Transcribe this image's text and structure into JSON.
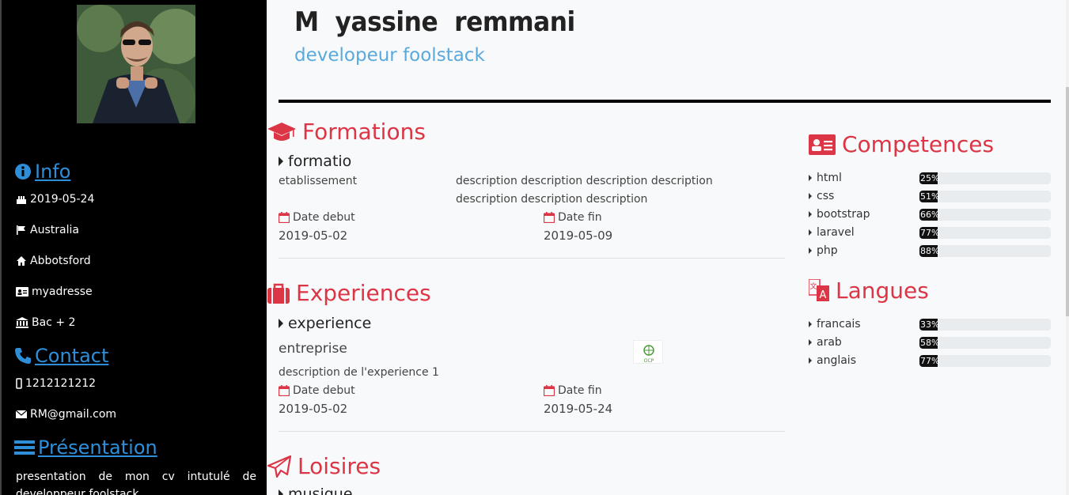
{
  "sidebar": {
    "info_heading": "Info",
    "info_items": [
      "2019-05-24",
      "Australia",
      "Abbotsford",
      "myadresse",
      "Bac + 2"
    ],
    "contact_heading": "Contact",
    "phone": "1212121212",
    "email": "RM@gmail.com",
    "presentation_heading": "Présentation",
    "presentation_text": "presentation de mon cv intutulé de developpeur foolstack"
  },
  "header": {
    "name": "M  yassine  remmani",
    "role": "developeur foolstack"
  },
  "formations": {
    "title": "Formations",
    "item_title": "formatio",
    "etablissement": "etablissement",
    "description_line1": "description description description description",
    "description_line2": "description description description",
    "date_debut_label": "Date debut",
    "date_debut": "2019-05-02",
    "date_fin_label": "Date fin",
    "date_fin": "2019-05-09"
  },
  "experiences": {
    "title": "Experiences",
    "item_title": "experience",
    "entreprise": "entreprise",
    "description": "description de l'experience 1",
    "date_debut_label": "Date debut",
    "date_debut": "2019-05-02",
    "date_fin_label": "Date fin",
    "date_fin": "2019-05-24",
    "logo_text": "OCP"
  },
  "loisires": {
    "title": "Loisires",
    "item_title": "musique"
  },
  "competences": {
    "title": "Competences",
    "items": [
      {
        "name": "html",
        "percent": 25,
        "label": "25%"
      },
      {
        "name": "css",
        "percent": 51,
        "label": "51%"
      },
      {
        "name": "bootstrap",
        "percent": 66,
        "label": "66%"
      },
      {
        "name": "laravel",
        "percent": 77,
        "label": "77%"
      },
      {
        "name": "php",
        "percent": 88,
        "label": "88%"
      }
    ]
  },
  "langues": {
    "title": "Langues",
    "items": [
      {
        "name": "francais",
        "percent": 33,
        "label": "33%"
      },
      {
        "name": "arab",
        "percent": 58,
        "label": "58%"
      },
      {
        "name": "anglais",
        "percent": 77,
        "label": "77%"
      }
    ]
  },
  "colors": {
    "accent_red": "#dc3545",
    "accent_blue": "#2e8fd8",
    "role_blue": "#5aa9dc",
    "sidebar_bg": "#000000"
  }
}
